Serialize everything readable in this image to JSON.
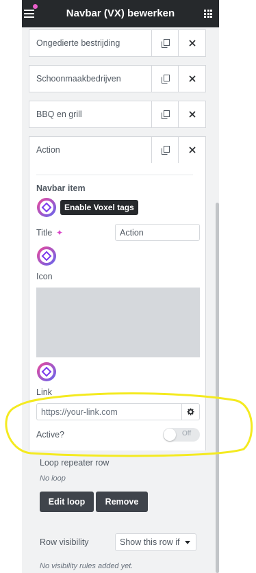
{
  "header": {
    "title": "Navbar (VX) bewerken",
    "menu_icon": "hamburger-icon",
    "apps_icon": "grid-icon",
    "notification_color": "#ea5ecb"
  },
  "repeater_items": [
    {
      "label": "Ongedierte bestrijding"
    },
    {
      "label": "Schoonmaakbedrijven"
    },
    {
      "label": "BBQ en grill"
    },
    {
      "label": "Action"
    }
  ],
  "item_form": {
    "section_title": "Navbar item",
    "tooltip": "Enable Voxel tags",
    "title_label": "Title",
    "title_value": "Action",
    "icon_label": "Icon",
    "link_label": "Link",
    "link_placeholder": "https://your-link.com",
    "active_label": "Active?",
    "active_toggle_text": "Off",
    "active_state": false
  },
  "loop": {
    "label": "Loop repeater row",
    "note": "No loop",
    "edit_button": "Edit loop",
    "remove_button": "Remove"
  },
  "visibility": {
    "label": "Row visibility",
    "select_value": "Show this row if",
    "note": "No visibility rules added yet."
  },
  "colors": {
    "header_bg": "#26292c",
    "panel_bg": "#f1f2f3",
    "annotation": "#f4ea20",
    "voxel_accent": "#8b5cf6"
  }
}
